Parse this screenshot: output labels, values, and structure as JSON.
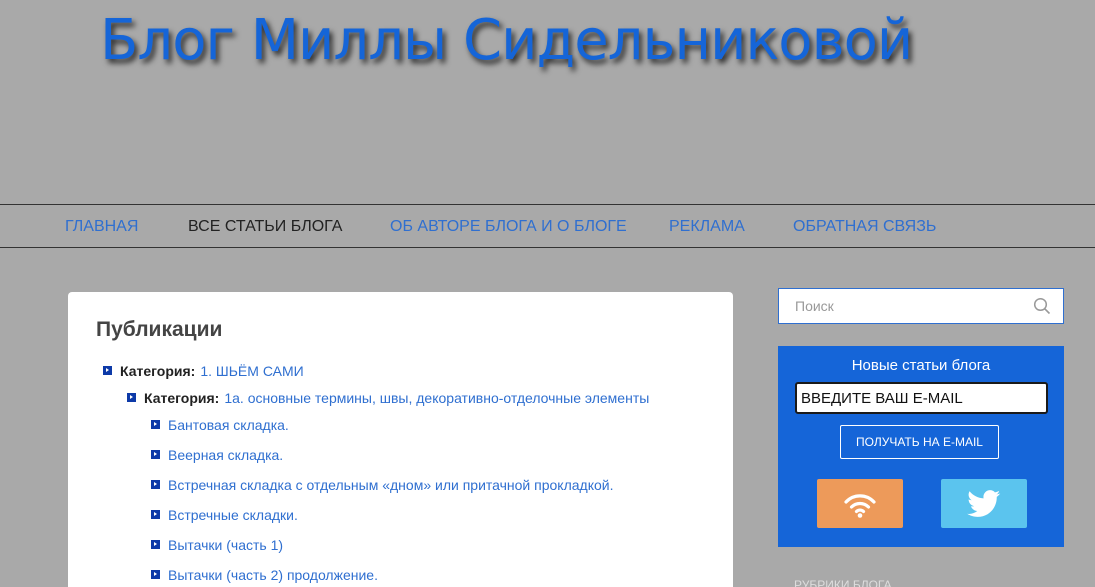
{
  "header": {
    "site_title": "Блог Миллы Сидельниковой"
  },
  "nav": {
    "items": [
      {
        "label": "ГЛАВНАЯ"
      },
      {
        "label": "ВСЕ СТАТЬИ БЛОГА"
      },
      {
        "label": "ОБ АВТОРЕ БЛОГА И О БЛОГЕ"
      },
      {
        "label": "РЕКЛАМА"
      },
      {
        "label": "ОБРАТНАЯ СВЯЗЬ"
      }
    ],
    "active_label": "ВСЕ СТАТЬИ БЛОГА"
  },
  "main": {
    "title": "Публикации",
    "category_prefix": "Категория:",
    "category_1": "1. ШЬЁМ САМИ",
    "category_1a": "1а. основные термины, швы, декоративно-отделочные элементы",
    "posts": [
      "Бантовая складка.",
      "Веерная складка.",
      "Встречная складка с отдельным «дном» или притачной прокладкой.",
      "Встречные складки.",
      "Вытачки (часть 1)",
      "Вытачки (часть 2) продолжение."
    ]
  },
  "sidebar": {
    "search_placeholder": "Поиск",
    "subscribe_title": "Новые статьи блога",
    "email_placeholder": "ВВЕДИТЕ ВАШ E-MAIL",
    "subscribe_button": "ПОЛУЧАТЬ НА E-MAIL",
    "rss_icon": "rss-icon",
    "twitter_icon": "twitter-icon",
    "rubrics_partial": "РУБРИКИ БЛОГА"
  },
  "colors": {
    "background": "#a9a9a9",
    "accent": "#1565d8",
    "link": "#2f6fd0",
    "rss": "#ed9a5a",
    "twitter": "#5bc4ee"
  }
}
